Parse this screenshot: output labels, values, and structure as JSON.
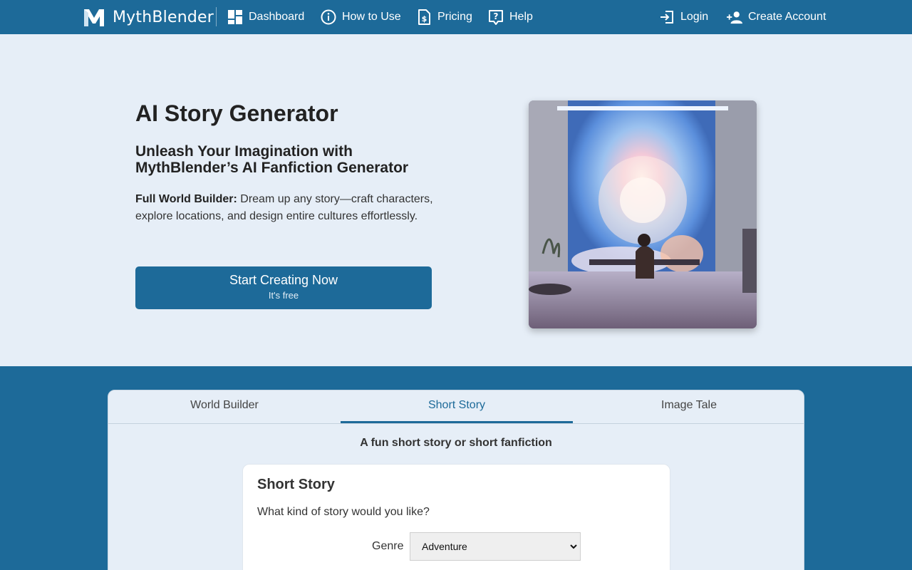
{
  "nav": {
    "brand": "MythBlender",
    "items": {
      "dashboard": "Dashboard",
      "how_to_use": "How to Use",
      "pricing": "Pricing",
      "help": "Help"
    },
    "login": "Login",
    "create_account": "Create Account"
  },
  "hero": {
    "title": "AI Story Generator",
    "subtitle": "Unleash Your Imagination with MythBlender’s AI Fanfiction Generator",
    "feature_label": "Full World Builder:",
    "feature_text": " Dream up any story—craft characters, explore locations, and design entire cultures effortlessly.",
    "cta_main": "Start Creating Now",
    "cta_sub": "It's free"
  },
  "tabs": [
    {
      "label": "World Builder",
      "active": false
    },
    {
      "label": "Short Story",
      "active": true
    },
    {
      "label": "Image Tale",
      "active": false
    }
  ],
  "panel": {
    "caption": "A fun short story or short fanfiction",
    "card_title": "Short Story",
    "question": "What kind of story would you like?",
    "genre_label": "Genre",
    "genre_value": "Adventure"
  },
  "colors": {
    "primary": "#1d6a99",
    "background": "#e6eef7"
  }
}
